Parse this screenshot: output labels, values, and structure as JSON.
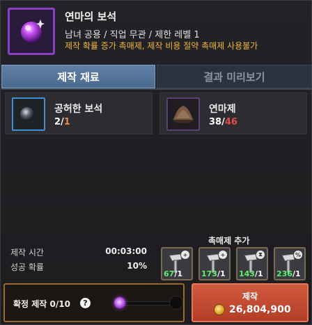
{
  "header": {
    "title": "연마의 보석",
    "subtitle": "남녀 공용 / 직업 무관 / 제한 레벨 1",
    "warning": "제작 확률 증가 촉매제, 제작 비용 절약 촉매제 사용불가",
    "item_icon": "purple-gem-icon"
  },
  "tabs": [
    {
      "label": "제작 재료",
      "active": true
    },
    {
      "label": "결과 미리보기",
      "active": false
    }
  ],
  "materials": [
    {
      "name": "공허한 보석",
      "have": "2",
      "sep": "/",
      "need": "1",
      "icon": "black-gem-icon"
    },
    {
      "name": "연마제",
      "have": "38",
      "sep": "/",
      "need": "46",
      "icon": "polishing-powder-icon"
    }
  ],
  "info": {
    "time_label": "제작 시간",
    "time_value": "00:03:00",
    "success_label": "성공 확률",
    "success_value": "10%"
  },
  "catalysts": {
    "title": "촉매제 추가",
    "items": [
      {
        "count": "67",
        "max": "/1",
        "badge": "+",
        "icon": "hammer-plus-icon"
      },
      {
        "count": "173",
        "max": "/1",
        "badge": "+",
        "icon": "hammer-plus-icon"
      },
      {
        "count": "143",
        "max": "/1",
        "badge": "⧗",
        "icon": "hammer-hourglass-icon"
      },
      {
        "count": "236",
        "max": "/1",
        "badge": "%",
        "icon": "hammer-percent-icon"
      }
    ]
  },
  "bottom": {
    "confirm_label": "확정 제작  0/10",
    "help_icon": "?",
    "slider_value": 0,
    "slider_max": 10
  },
  "craft": {
    "label": "제작",
    "cost": "26,804,900",
    "coin_icon": "gold-coin-icon"
  },
  "colors": {
    "accent_purple": "#8a3fc7",
    "warning_orange": "#f0b63c",
    "tab_active": "#5f7fa4",
    "craft_red": "#c44a32",
    "count_green": "#5cf06a",
    "need_red": "#e34b4b"
  }
}
